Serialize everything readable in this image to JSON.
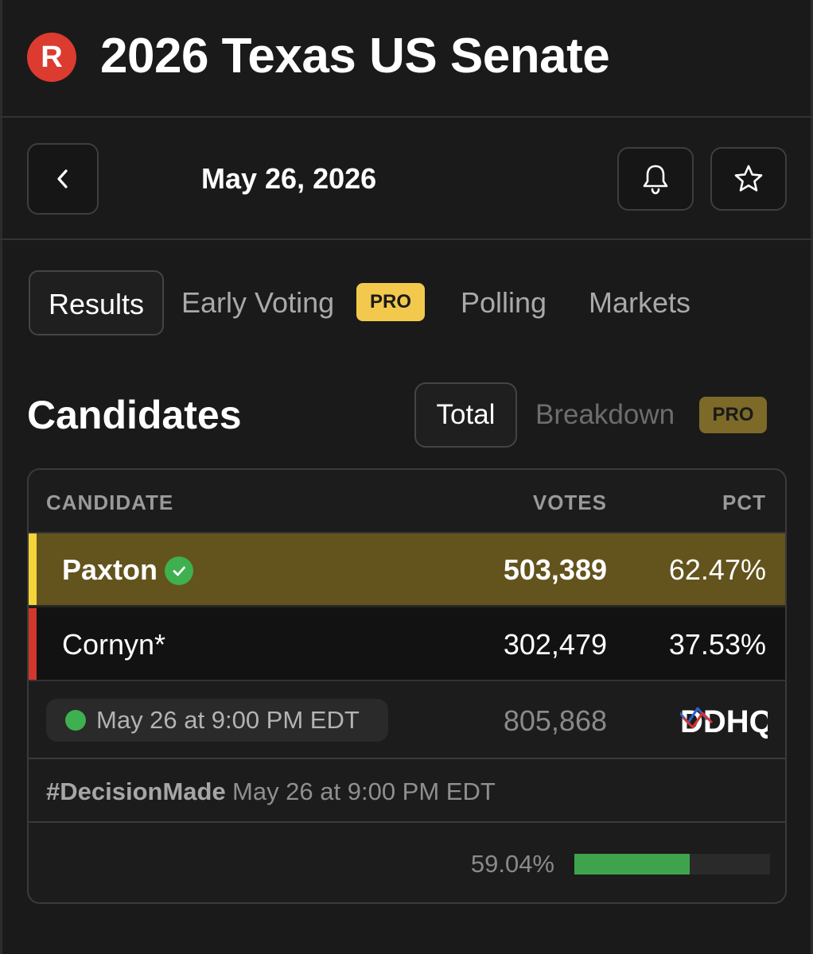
{
  "header": {
    "logo_letter": "R",
    "title": "2026 Texas US Senate"
  },
  "datebar": {
    "date": "May 26, 2026",
    "icons": [
      "chevron-left-icon",
      "bell-icon",
      "star-icon"
    ]
  },
  "tabs": [
    {
      "label": "Results",
      "active": true
    },
    {
      "label": "Early Voting",
      "badge": "PRO"
    },
    {
      "label": "Polling"
    },
    {
      "label": "Markets"
    }
  ],
  "candidates_section": {
    "title": "Candidates",
    "toggle_total": "Total",
    "toggle_breakdown": "Breakdown",
    "breakdown_badge": "PRO"
  },
  "table": {
    "headers": {
      "candidate": "CANDIDATE",
      "votes": "VOTES",
      "pct": "PCT"
    },
    "rows": [
      {
        "name": "Paxton",
        "votes": "503,389",
        "pct": "62.47%",
        "winner": true,
        "party_color": "#f5d43a"
      },
      {
        "name": "Cornyn*",
        "votes": "302,479",
        "pct": "37.53%",
        "winner": false,
        "party_color": "#d2372b"
      }
    ],
    "status_time": "May 26 at 9:00 PM EDT",
    "total_votes": "805,868",
    "source": "DDHQ",
    "decision_tag": "#DecisionMade",
    "decision_time": "May 26 at 9:00 PM EDT",
    "reporting_pct": "59.04%",
    "reporting_fraction": 0.5904
  },
  "colors": {
    "background": "#1a1a1a",
    "winner_row": "#63531d",
    "pro_badge": "#f2c94c",
    "logo": "#dc3b2f",
    "success": "#3fb04f"
  }
}
